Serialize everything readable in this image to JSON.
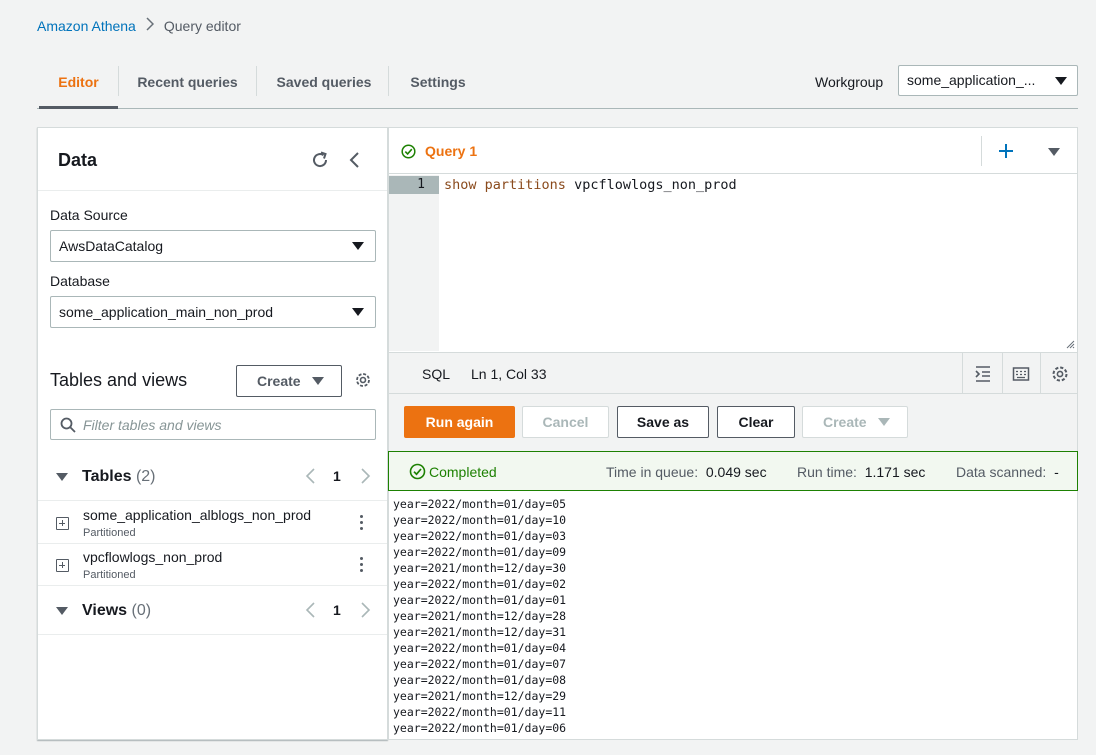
{
  "breadcrumb": {
    "root": "Amazon Athena",
    "current": "Query editor"
  },
  "tabs": [
    "Editor",
    "Recent queries",
    "Saved queries",
    "Settings"
  ],
  "workgroup": {
    "label": "Workgroup",
    "value": "some_application_..."
  },
  "data_panel": {
    "title": "Data",
    "data_source_label": "Data Source",
    "data_source_value": "AwsDataCatalog",
    "database_label": "Database",
    "database_value": "some_application_main_non_prod",
    "tables_views_title": "Tables and views",
    "create_label": "Create",
    "search_placeholder": "Filter tables and views",
    "tables_title": "Tables",
    "tables_count": "(2)",
    "tables_page": "1",
    "tables": [
      {
        "name": "some_application_alblogs_non_prod",
        "sub": "Partitioned"
      },
      {
        "name": "vpcflowlogs_non_prod",
        "sub": "Partitioned"
      }
    ],
    "views_title": "Views",
    "views_count": "(0)",
    "views_page": "1"
  },
  "query": {
    "tab_label": "Query 1",
    "line_number": "1",
    "code_kw1": "show",
    "code_kw2": "partitions",
    "code_rest": " vpcflowlogs_non_prod",
    "language": "SQL",
    "cursor": "Ln 1, Col 33"
  },
  "actions": {
    "run": "Run again",
    "cancel": "Cancel",
    "save": "Save as",
    "clear": "Clear",
    "create": "Create"
  },
  "status": {
    "state": "Completed",
    "queue_label": "Time in queue:",
    "queue_value": "0.049 sec",
    "run_label": "Run time:",
    "run_value": "1.171 sec",
    "scanned_label": "Data scanned:",
    "scanned_value": "-"
  },
  "results": [
    "year=2022/month=01/day=05",
    "year=2022/month=01/day=10",
    "year=2022/month=01/day=03",
    "year=2022/month=01/day=09",
    "year=2021/month=12/day=30",
    "year=2022/month=01/day=02",
    "year=2022/month=01/day=01",
    "year=2021/month=12/day=28",
    "year=2021/month=12/day=31",
    "year=2022/month=01/day=04",
    "year=2022/month=01/day=07",
    "year=2022/month=01/day=08",
    "year=2021/month=12/day=29",
    "year=2022/month=01/day=11",
    "year=2022/month=01/day=06"
  ],
  "colors": {
    "accent": "#ec7211",
    "link": "#0073bb",
    "success": "#1d8102"
  }
}
